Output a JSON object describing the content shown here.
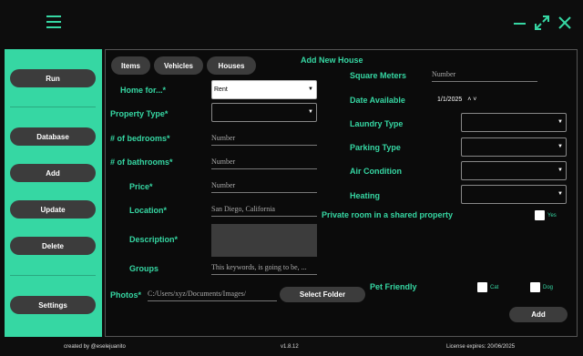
{
  "titlebar": {
    "menu_icon": "hamburger-icon",
    "minimize_icon": "minimize-icon",
    "maximize_icon": "maximize-icon",
    "close_icon": "close-icon"
  },
  "sidebar": {
    "buttons": [
      "Run",
      "Database",
      "Add",
      "Update",
      "Delete",
      "Settings"
    ]
  },
  "tabs": [
    "Items",
    "Vehicles",
    "Houses"
  ],
  "form": {
    "title": "Add New House",
    "home_for_label": "Home for...*",
    "home_for_value": "Rent",
    "property_type_label": "Property Type*",
    "bedrooms_label": "# of bedrooms*",
    "bedrooms_placeholder": "Number",
    "bathrooms_label": "# of bathrooms*",
    "bathrooms_placeholder": "Number",
    "price_label": "Price*",
    "price_placeholder": "Number",
    "location_label": "Location*",
    "location_value": "San Diego, California",
    "description_label": "Description*",
    "groups_label": "Groups",
    "groups_value": "This keywords, is going to be, ...",
    "photos_label": "Photos*",
    "photos_path": "C:/Users/xyz/Documents/Images/",
    "select_folder_label": "Select Folder",
    "square_meters_label": "Square Meters",
    "square_meters_placeholder": "Number",
    "date_available_label": "Date Available",
    "date_value": "1/1/2025",
    "date_spinner": "˄ ˅",
    "laundry_label": "Laundry Type",
    "parking_label": "Parking Type",
    "air_label": "Air Condition",
    "heating_label": "Heating",
    "private_room_label": "Private room in a shared property",
    "private_room_yes": "Yes",
    "pet_label": "Pet Friendly",
    "cat_label": "Cat",
    "dog_label": "Dog",
    "add_label": "Add",
    "dropdown_arrow": "▼"
  },
  "footer": {
    "credit": "created by @eselejuanito",
    "version": "v1.8.12",
    "license": "License expires: 20/06/2025"
  },
  "colors": {
    "accent": "#36d7a3",
    "background": "#0d0d0d",
    "button": "#3c3c3c"
  }
}
